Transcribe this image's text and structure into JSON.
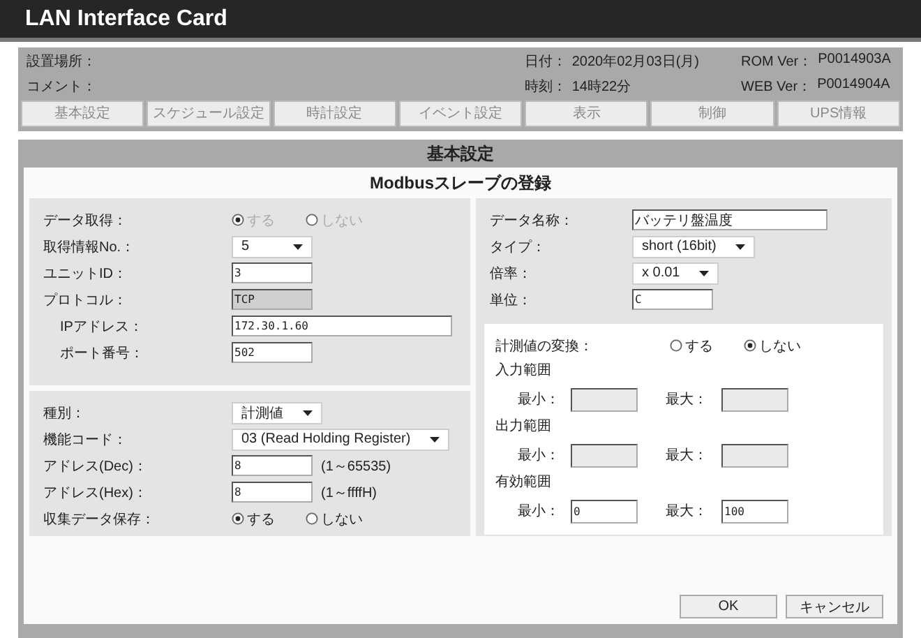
{
  "header": {
    "title": "LAN Interface Card"
  },
  "info": {
    "location_label": "設置場所：",
    "comment_label": "コメント：",
    "date_label": "日付：",
    "date": "2020年02月03日(月)",
    "time_label": "時刻：",
    "time": "14時22分",
    "rom_label": "ROM Ver：",
    "rom": "P0014903A",
    "web_label": "WEB Ver：",
    "web": "P0014904A"
  },
  "tabs": [
    {
      "label": "基本設定"
    },
    {
      "label": "スケジュール設定"
    },
    {
      "label": "時計設定"
    },
    {
      "label": "イベント設定"
    },
    {
      "label": "表示"
    },
    {
      "label": "制御"
    },
    {
      "label": "UPS情報"
    }
  ],
  "section_title": "基本設定",
  "form": {
    "title": "Modbusスレーブの登録",
    "left_groups": [
      {
        "rows": [
          {
            "kind": "radio",
            "label": "データ取得：",
            "disabled": true,
            "options": [
              {
                "label": "する",
                "selected": true
              },
              {
                "label": "しない",
                "selected": false
              }
            ]
          },
          {
            "kind": "select",
            "label": "取得情報No.：",
            "value": "5"
          },
          {
            "kind": "text",
            "label": "ユニットID：",
            "value": "3"
          },
          {
            "kind": "static",
            "label": "プロトコル：",
            "value": "TCP",
            "children": [
              {
                "kind": "wide_text",
                "label": "IPアドレス：",
                "value": "172.30.1.60"
              },
              {
                "kind": "text",
                "label": "ポート番号：",
                "value": "502"
              }
            ]
          }
        ]
      },
      {
        "rows": [
          {
            "kind": "select",
            "label": "種別：",
            "value": "計測値"
          },
          {
            "kind": "select",
            "label": "機能コード：",
            "value": "03 (Read Holding Register)"
          },
          {
            "kind": "text",
            "label": "アドレス(Dec)：",
            "value": "8",
            "hint": "(1～65535)"
          },
          {
            "kind": "text",
            "label": "アドレス(Hex)：",
            "value": "8",
            "hint": "(1～ffffH)"
          },
          {
            "kind": "radio",
            "label": "収集データ保存：",
            "disabled": false,
            "options": [
              {
                "label": "する",
                "selected": true
              },
              {
                "label": "しない",
                "selected": false
              }
            ]
          }
        ]
      }
    ],
    "right": {
      "rows": [
        {
          "kind": "wide_text",
          "label": "データ名称：",
          "value": "バッテリ盤温度"
        },
        {
          "kind": "select",
          "label": "タイプ：",
          "value": "short (16bit)"
        },
        {
          "kind": "select",
          "label": "倍率：",
          "value": "x 0.01"
        },
        {
          "kind": "text",
          "label": "単位：",
          "value": "C"
        }
      ],
      "conversion": {
        "label": "計測値の変換：",
        "options": [
          {
            "label": "する",
            "selected": false
          },
          {
            "label": "しない",
            "selected": true
          }
        ],
        "ranges": [
          {
            "title": "入力範囲",
            "min_label": "最小：",
            "max_label": "最大：",
            "disabled": true
          },
          {
            "title": "出力範囲",
            "min_label": "最小：",
            "max_label": "最大：",
            "disabled": true
          },
          {
            "title": "有効範囲",
            "min_label": "最小：",
            "max_label": "最大：",
            "disabled": false,
            "min": "0",
            "max": "100"
          }
        ]
      }
    }
  },
  "buttons": [
    {
      "label": "OK"
    },
    {
      "label": "キャンセル"
    }
  ]
}
